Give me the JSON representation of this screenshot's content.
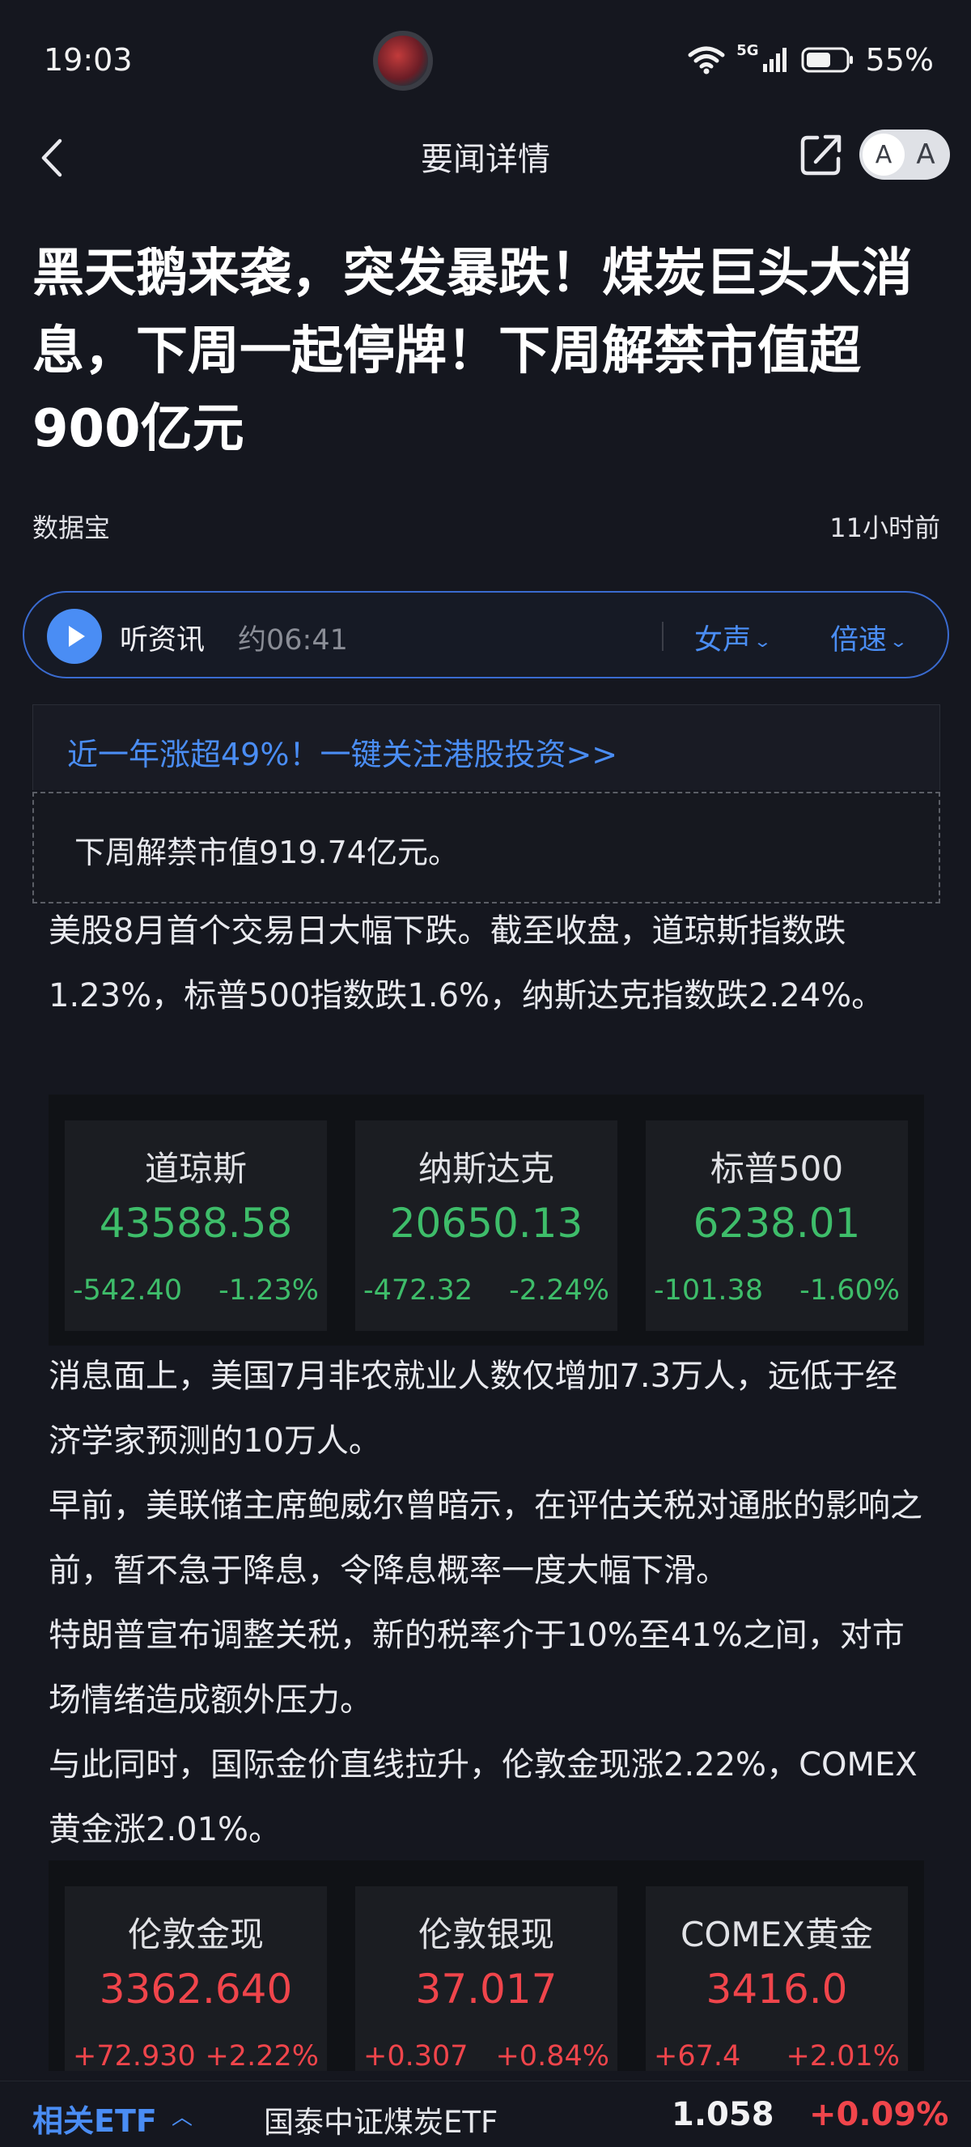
{
  "status_bar": {
    "time": "19:03",
    "network": "5G",
    "battery": "55%"
  },
  "nav": {
    "title": "要闻详情",
    "font_small": "A",
    "font_large": "A"
  },
  "article": {
    "headline": "黑天鹅来袭，突发暴跌！煤炭巨头大消息，下周一起停牌！下周解禁市值超900亿元",
    "source": "数据宝",
    "time_ago": "11小时前"
  },
  "audio": {
    "label": "听资讯",
    "duration": "约06:41",
    "voice": "女声",
    "speed": "倍速"
  },
  "promo": {
    "text": "近一年涨超49%！一键关注港股投资>>"
  },
  "summary": "下周解禁市值919.74亿元。",
  "paragraphs": [
    "美股8月首个交易日大幅下跌。截至收盘，道琼斯指数跌1.23%，标普500指数跌1.6%，纳斯达克指数跌2.24%。",
    "消息面上，美国7月非农就业人数仅增加7.3万人，远低于经济学家预测的10万人。",
    "早前，美联储主席鲍威尔曾暗示，在评估关税对通胀的影响之前，暂不急于降息，令降息概率一度大幅下滑。",
    "特朗普宣布调整关税，新的税率介于10%至41%之间，对市场情绪造成额外压力。",
    "与此同时，国际金价直线拉升，伦敦金现涨2.22%，COMEX黄金涨2.01%。"
  ],
  "indices_us": [
    {
      "name": "道琼斯",
      "price": "43588.58",
      "change": "-542.40",
      "pct": "-1.23%"
    },
    {
      "name": "纳斯达克",
      "price": "20650.13",
      "change": "-472.32",
      "pct": "-2.24%"
    },
    {
      "name": "标普500",
      "price": "6238.01",
      "change": "-101.38",
      "pct": "-1.60%"
    }
  ],
  "indices_metals": [
    {
      "name": "伦敦金现",
      "price": "3362.640",
      "change": "+72.930",
      "pct": "+2.22%"
    },
    {
      "name": "伦敦银现",
      "price": "37.017",
      "change": "+0.307",
      "pct": "+0.84%"
    },
    {
      "name": "COMEX黄金",
      "price": "3416.0",
      "change": "+67.4",
      "pct": "+2.01%"
    }
  ],
  "etf_bar": {
    "label": "相关ETF",
    "name": "国泰中证煤炭ETF",
    "price": "1.058",
    "pct": "+0.09%"
  },
  "colors": {
    "accent": "#4a8df4",
    "down": "#3ebd6a",
    "up": "#f0454b",
    "background": "#15171f"
  }
}
